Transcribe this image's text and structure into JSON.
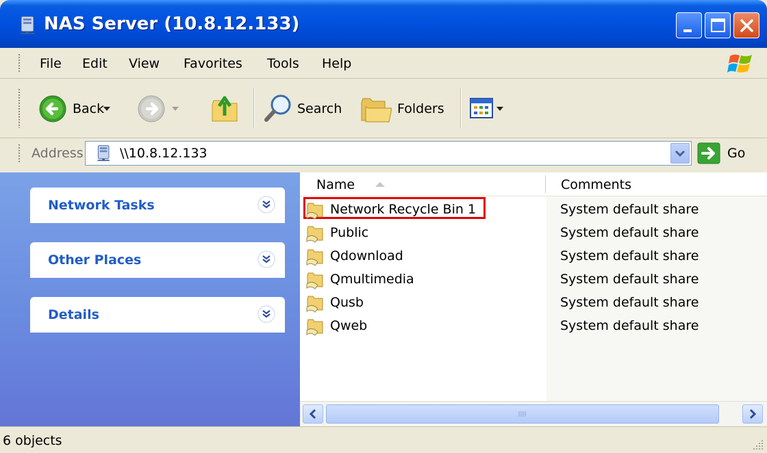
{
  "window": {
    "title": "NAS Server (10.8.12.133)"
  },
  "menu": {
    "items": [
      "File",
      "Edit",
      "View",
      "Favorites",
      "Tools",
      "Help"
    ]
  },
  "toolbar": {
    "back_label": "Back",
    "search_label": "Search",
    "folders_label": "Folders"
  },
  "address": {
    "label": "Address",
    "value": "\\\\10.8.12.133",
    "go_label": "Go"
  },
  "tasks": {
    "panels": [
      "Network Tasks",
      "Other Places",
      "Details"
    ]
  },
  "list": {
    "columns": [
      "Name",
      "Comments"
    ],
    "rows": [
      {
        "name": "Network Recycle Bin 1",
        "comment": "System default share"
      },
      {
        "name": "Public",
        "comment": "System default share"
      },
      {
        "name": "Qdownload",
        "comment": "System default share"
      },
      {
        "name": "Qmultimedia",
        "comment": "System default share"
      },
      {
        "name": "Qusb",
        "comment": "System default share"
      },
      {
        "name": "Qweb",
        "comment": "System default share"
      }
    ]
  },
  "status": {
    "text": "6 objects"
  },
  "colors": {
    "title_bar": "#0052e0",
    "task_pane": "#6a8ce0",
    "task_title": "#215dc6",
    "highlight_border": "#e00000"
  }
}
